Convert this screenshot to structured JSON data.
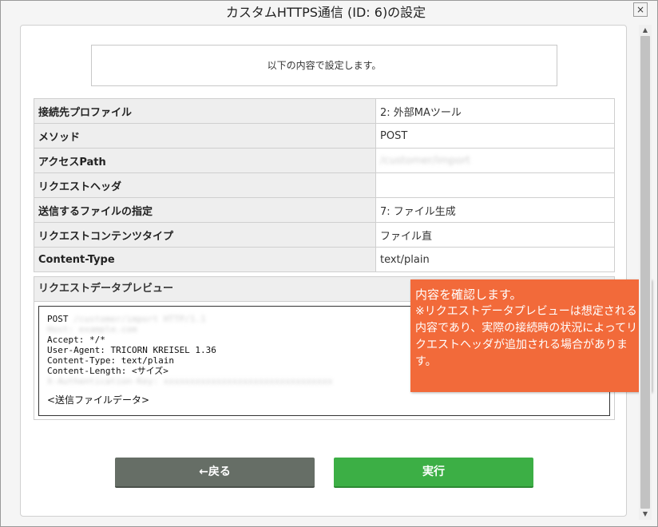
{
  "dialog": {
    "title": "カスタムHTTPS通信 (ID: 6)の設定",
    "close_icon": "×"
  },
  "notice": "以下の内容で設定します。",
  "settings": {
    "rows": [
      {
        "label": "接続先プロファイル",
        "value": "2: 外部MAツール"
      },
      {
        "label": "メソッド",
        "value": "POST"
      },
      {
        "label": "アクセスPath",
        "value": "/customer/import"
      },
      {
        "label": "リクエストヘッダ",
        "value": ""
      },
      {
        "label": "送信するファイルの指定",
        "value": "7: ファイル生成"
      },
      {
        "label": "リクエストコンテンツタイプ",
        "value": "ファイル直"
      },
      {
        "label": "Content-Type",
        "value": "text/plain"
      }
    ]
  },
  "preview": {
    "header": "リクエストデータプレビュー",
    "lines": [
      "POST /customer/import HTTP/1.1",
      "Host: example.com",
      "Accept: */*",
      "User-Agent: TRICORN KREISEL 1.36",
      "Content-Type: text/plain",
      "Content-Length: <サイズ>",
      "X-Authentication-Key: xxxxxxxxxxxxxxxxxxxxxxxxxxxxxxxx"
    ],
    "file_placeholder": "<送信ファイルデータ>"
  },
  "tooltip": {
    "title": "内容を確認します。",
    "body": "※リクエストデータプレビューは想定される内容であり、実際の接続時の状況によってリクエストヘッダが追加される場合があります。"
  },
  "buttons": {
    "back_label": "←戻る",
    "run_label": "実行"
  },
  "scrollbar": {
    "up_icon": "▲",
    "down_icon": "▼"
  },
  "colors": {
    "tooltip_bg": "#f26a3a",
    "run_button": "#3caf45",
    "back_button": "#666e66"
  }
}
